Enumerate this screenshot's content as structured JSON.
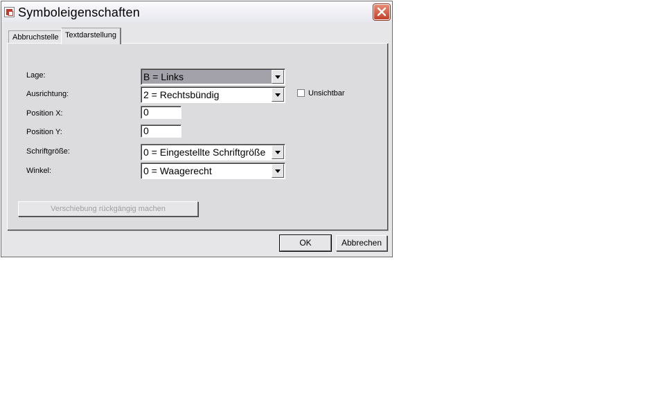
{
  "window": {
    "title": "Symboleigenschaften"
  },
  "tabs": [
    {
      "label": "Abbruchstelle",
      "active": false
    },
    {
      "label": "Textdarstellung",
      "active": true
    }
  ],
  "form": {
    "lage": {
      "label": "Lage:",
      "value": "B = Links"
    },
    "ausrichtung": {
      "label": "Ausrichtung:",
      "value": "2 = Rechtsbündig"
    },
    "unsichtbar": {
      "label": "Unsichtbar",
      "checked": false
    },
    "position_x": {
      "label": "Position X:",
      "value": "0"
    },
    "position_y": {
      "label": "Position Y:",
      "value": "0"
    },
    "schriftgroesse": {
      "label": "Schriftgröße:",
      "value": "0 = Eingestellte Schriftgröße"
    },
    "winkel": {
      "label": "Winkel:",
      "value": "0 = Waagerecht"
    },
    "undo_button": "Verschiebung rückgängig machen"
  },
  "buttons": {
    "ok": "OK",
    "cancel": "Abbrechen"
  },
  "colors": {
    "selection": "#a3a2ab",
    "close_button": "#c2412a",
    "dialog_bg": "#e6e5e8"
  }
}
